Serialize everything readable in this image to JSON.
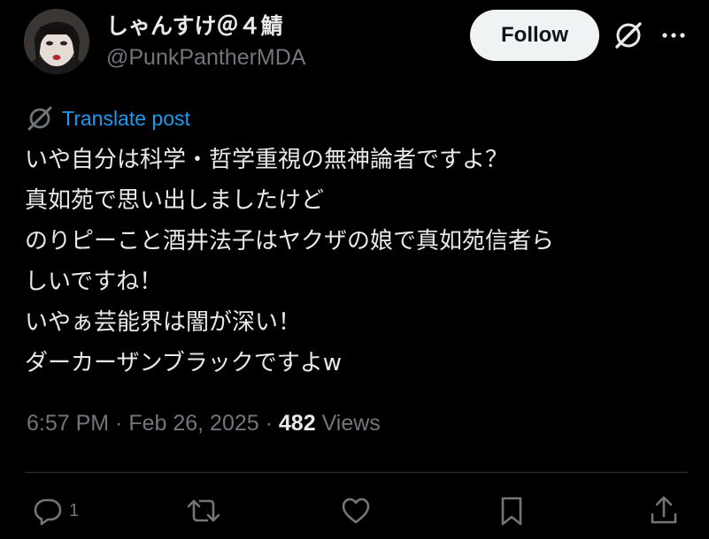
{
  "author": {
    "display_name": "しゃんすけ＠４鯖",
    "handle": "@PunkPantherMDA",
    "avatar_alt": "profile picture"
  },
  "header": {
    "follow_label": "Follow",
    "grok_icon": "grok-icon",
    "more_icon": "more-icon"
  },
  "translate": {
    "label": "Translate post",
    "icon": "translate-icon"
  },
  "post": {
    "lines": [
      "いや自分は科学・哲学重視の無神論者ですよ？",
      "真如苑で思い出しましたけど",
      "のりピーこと酒井法子はヤクザの娘で真如苑信者ら",
      "しいですね！",
      "いやぁ芸能界は闇が深い！",
      "ダーカーザンブラックですよw"
    ]
  },
  "meta": {
    "time": "6:57 PM",
    "separator": " · ",
    "date": "Feb 26, 2025",
    "views_count": "482",
    "views_label": "Views"
  },
  "actions": {
    "reply_count": "1",
    "reply_icon": "reply-icon",
    "repost_icon": "repost-icon",
    "like_icon": "like-icon",
    "bookmark_icon": "bookmark-icon",
    "share_icon": "share-icon"
  },
  "colors": {
    "background": "#000000",
    "text_primary": "#e7e9ea",
    "text_secondary": "#71767b",
    "link": "#1d9bf0",
    "follow_bg": "#eff3f4",
    "divider": "#2f3336"
  }
}
